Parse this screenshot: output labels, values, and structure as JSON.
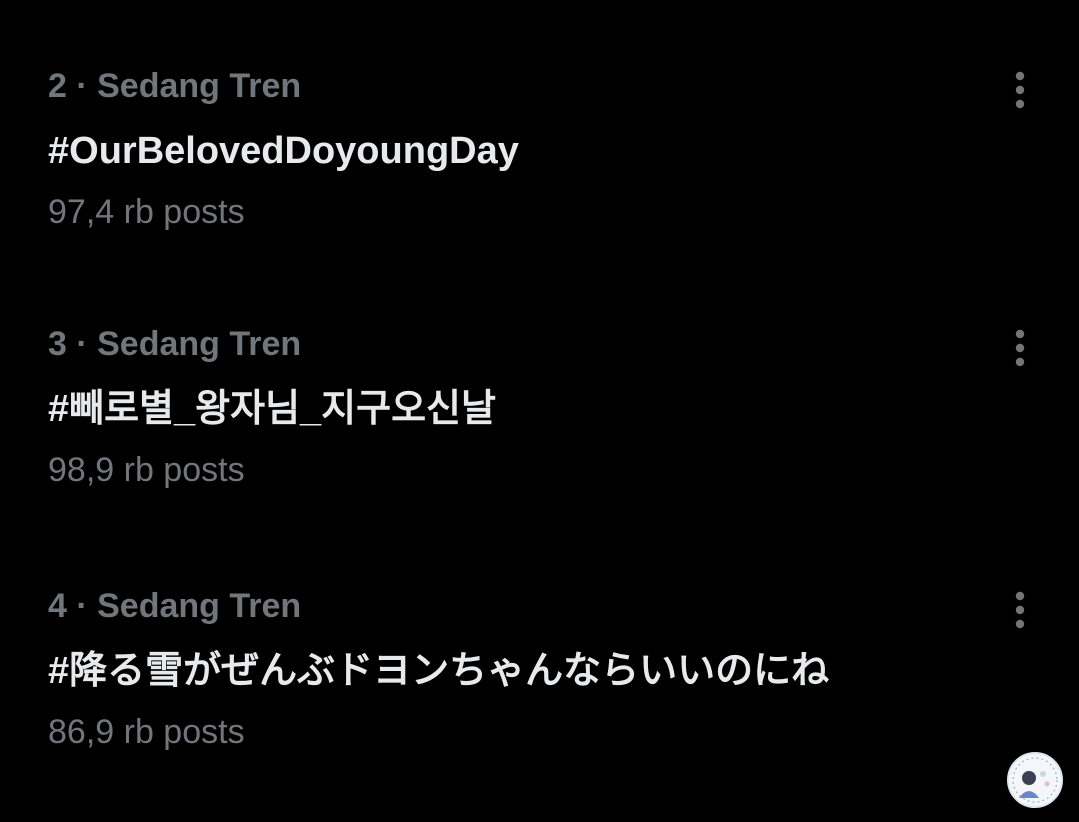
{
  "trends": [
    {
      "rank": "2",
      "separator": "·",
      "category": "Sedang Tren",
      "meta": "2 · Sedang Tren",
      "title": "#OurBelovedDoyoungDay",
      "count": "97,4 rb posts",
      "more_icon": "more-vertical-icon"
    },
    {
      "rank": "3",
      "separator": "·",
      "category": "Sedang Tren",
      "meta": "3 · Sedang Tren",
      "title": "#빼로별_왕자님_지구오신날",
      "count": "98,9 rb posts",
      "more_icon": "more-vertical-icon"
    },
    {
      "rank": "4",
      "separator": "·",
      "category": "Sedang Tren",
      "meta": "4 · Sedang Tren",
      "title": "#降る雪がぜんぶドヨンちゃんならいいのにね",
      "count": "86,9 rb posts",
      "more_icon": "more-vertical-icon"
    }
  ],
  "colors": {
    "background": "#000000",
    "primary_text": "#e7e9ea",
    "secondary_text": "#71767b"
  }
}
